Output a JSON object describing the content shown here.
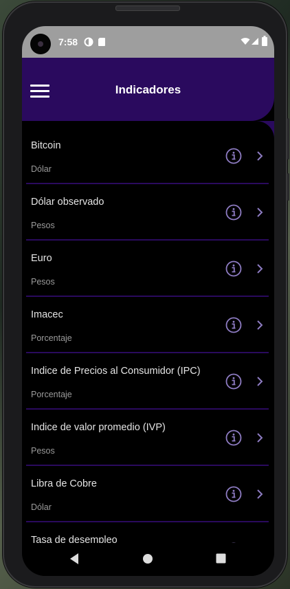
{
  "statusbar": {
    "time": "7:58"
  },
  "appbar": {
    "title": "Indicadores"
  },
  "items": [
    {
      "title": "Bitcoin",
      "unit": "Dólar"
    },
    {
      "title": "Dólar observado",
      "unit": "Pesos"
    },
    {
      "title": "Euro",
      "unit": "Pesos"
    },
    {
      "title": "Imacec",
      "unit": "Porcentaje"
    },
    {
      "title": "Indice de Precios al Consumidor (IPC)",
      "unit": "Porcentaje"
    },
    {
      "title": "Indice de valor promedio (IVP)",
      "unit": "Pesos"
    },
    {
      "title": "Libra de Cobre",
      "unit": "Dólar"
    },
    {
      "title": "Tasa de desempleo",
      "unit": ""
    }
  ],
  "colors": {
    "appbar": "#2a0a5e",
    "accent_icon": "#8e7cc3",
    "background": "#000000",
    "statusbar": "#9e9e9e"
  },
  "icons": {
    "menu": "menu-icon",
    "info": "info-icon",
    "chevron": "chevron-right-icon",
    "back": "back-icon",
    "home": "home-icon",
    "recents": "recents-icon"
  }
}
